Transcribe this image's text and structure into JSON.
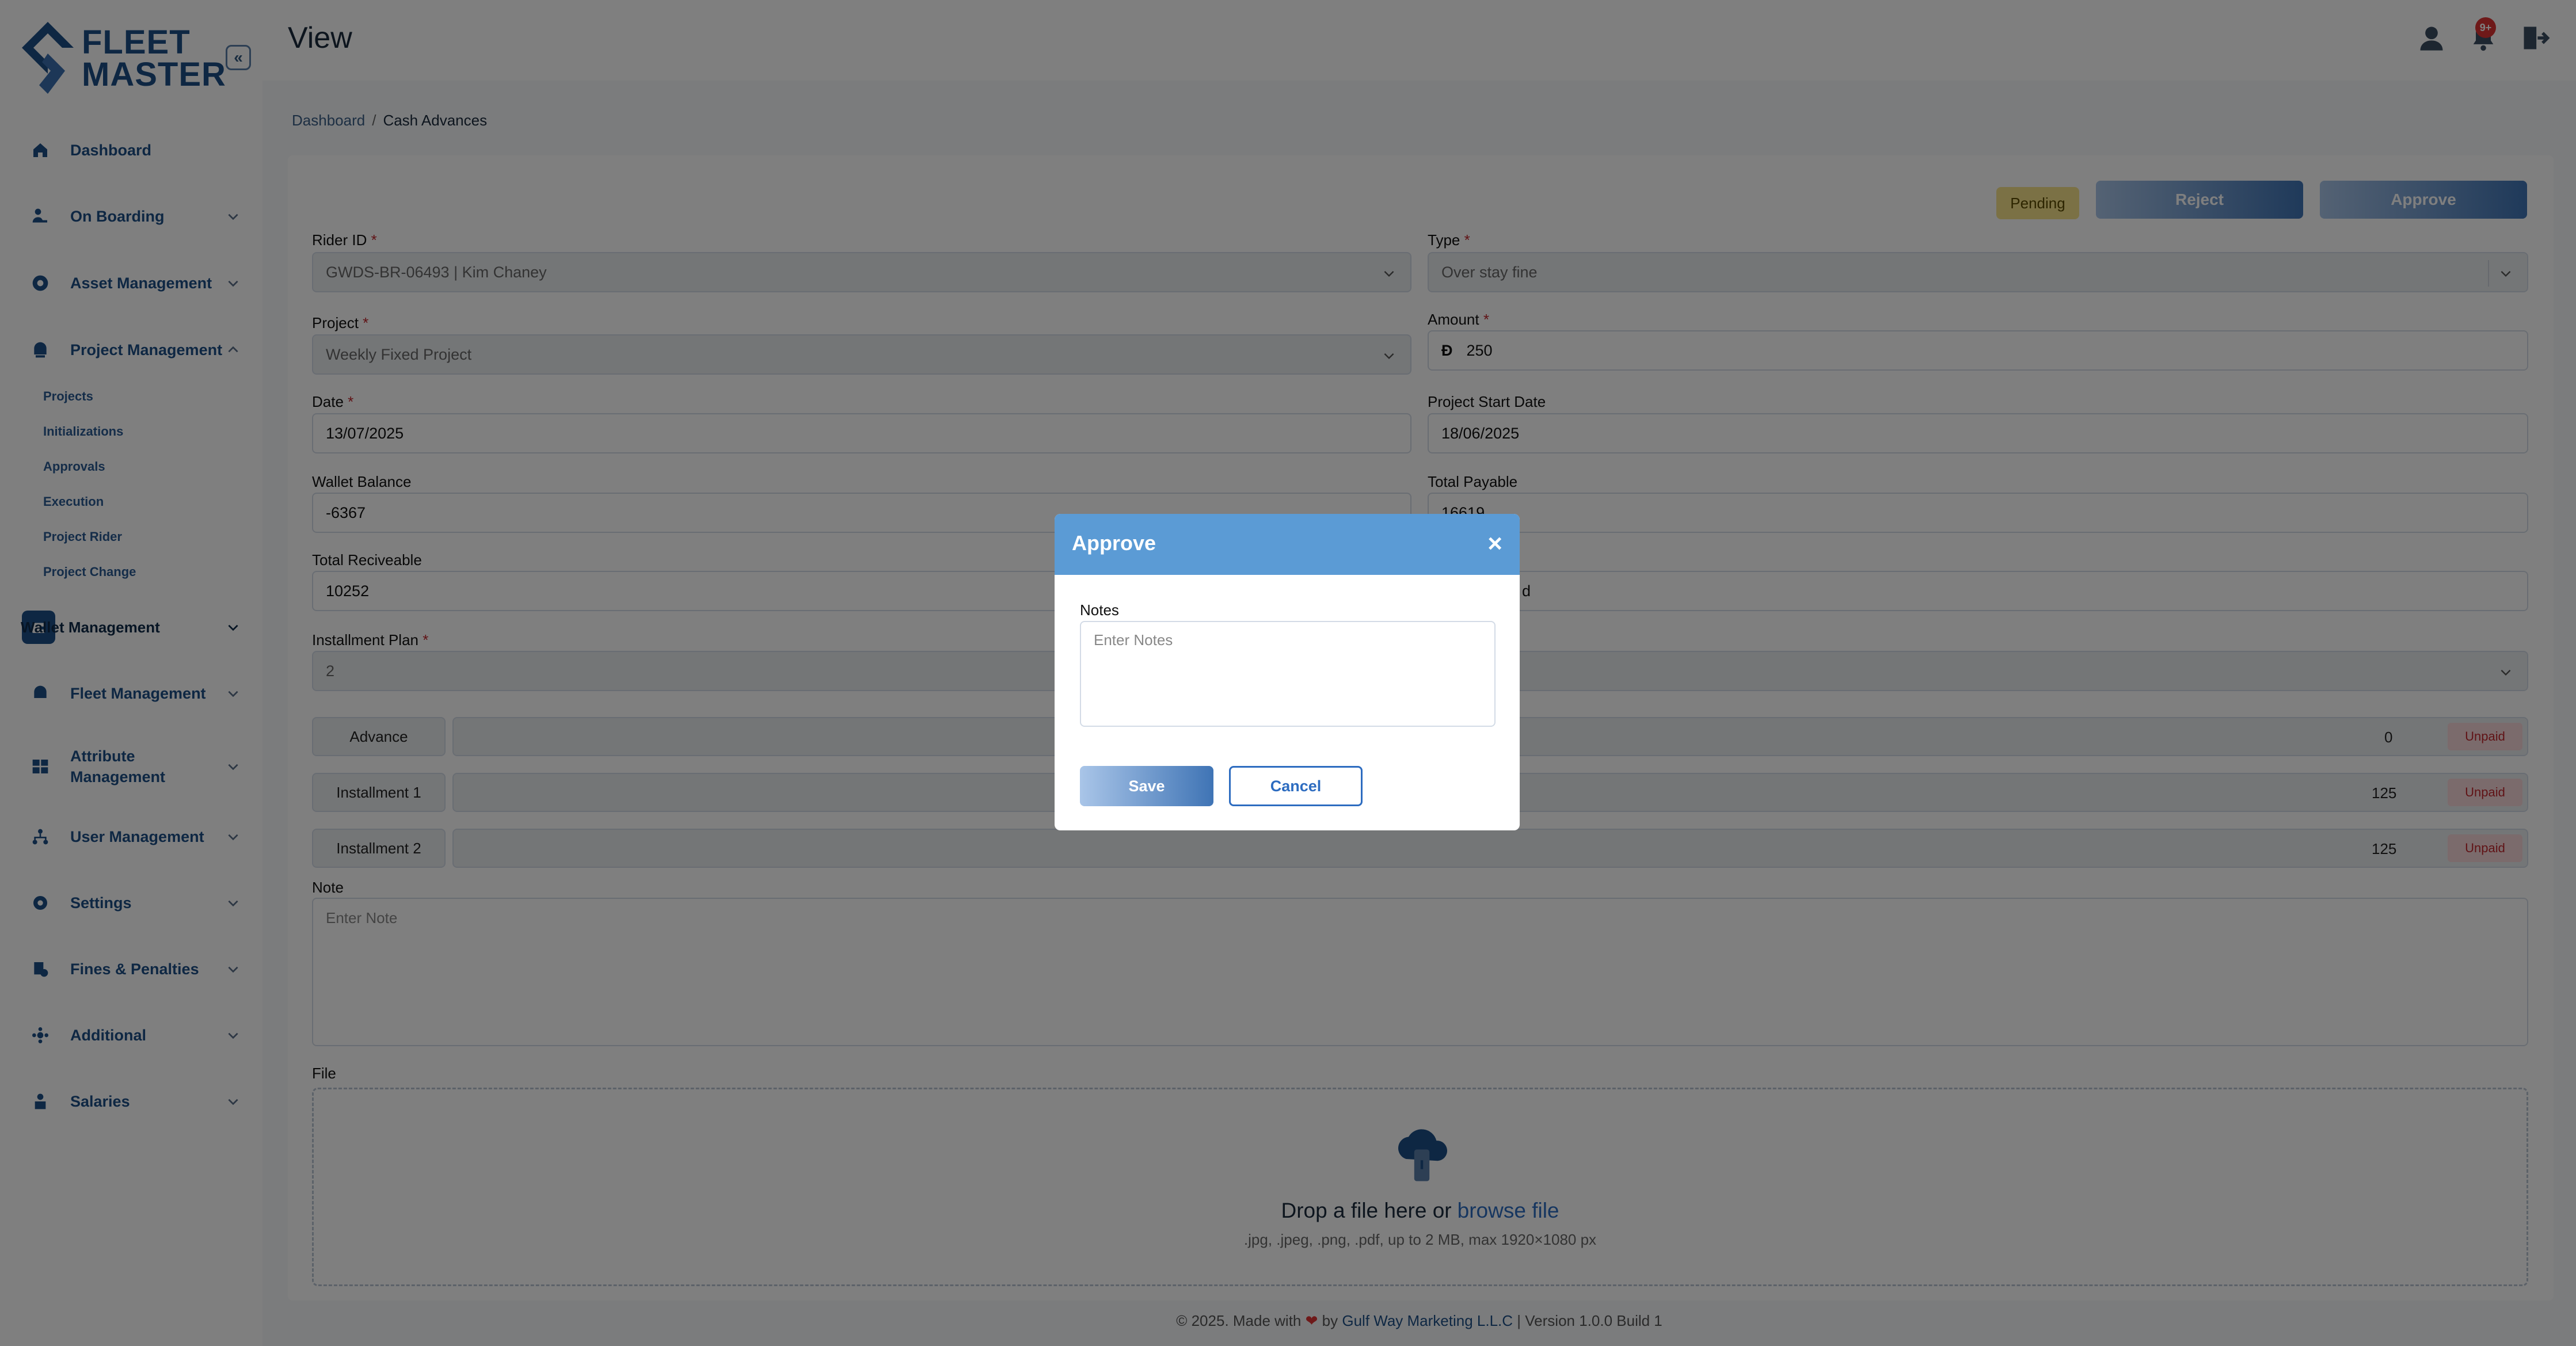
{
  "brand": {
    "line1": "FLEET",
    "line2": "MASTER"
  },
  "header": {
    "title": "View",
    "badge": "9+"
  },
  "sidebar": {
    "items": [
      {
        "label": "Dashboard"
      },
      {
        "label": "On Boarding"
      },
      {
        "label": "Asset Management"
      },
      {
        "label": "Project Management"
      },
      {
        "label": "Wallet Management"
      },
      {
        "label": "Fleet Management"
      },
      {
        "label": "Attribute Management"
      },
      {
        "label": "User Management"
      },
      {
        "label": "Settings"
      },
      {
        "label": "Fines & Penalties"
      },
      {
        "label": "Additional"
      },
      {
        "label": "Salaries"
      }
    ],
    "sub": [
      "Projects",
      "Initializations",
      "Approvals",
      "Execution",
      "Project Rider",
      "Project Change"
    ]
  },
  "breadcrumb": {
    "root": "Dashboard",
    "sep": "/",
    "current": "Cash Advances"
  },
  "status": {
    "pending": "Pending",
    "reject": "Reject",
    "approve": "Approve"
  },
  "form": {
    "rider_id": {
      "label": "Rider ID",
      "value": "GWDS-BR-06493 | Kim Chaney"
    },
    "type": {
      "label": "Type",
      "value": "Over stay fine"
    },
    "project": {
      "label": "Project",
      "value": "Weekly Fixed Project"
    },
    "amount": {
      "label": "Amount",
      "currency": "Ð",
      "value": "250"
    },
    "date": {
      "label": "Date",
      "value": "13/07/2025"
    },
    "project_start": {
      "label": "Project Start Date",
      "value": "18/06/2025"
    },
    "wallet_balance": {
      "label": "Wallet Balance",
      "value": "-6367"
    },
    "total_payable": {
      "label": "Total Payable",
      "value": "16619"
    },
    "total_receivable": {
      "label": "Total Reciveable",
      "value": "10252"
    },
    "hidden_right_value": "d",
    "installment_plan": {
      "label": "Installment Plan",
      "value": "2"
    },
    "required_mark": "*",
    "installments": [
      {
        "label": "Advance",
        "amount": "0",
        "status": "Unpaid"
      },
      {
        "label": "Installment 1",
        "amount": "125",
        "status": "Unpaid"
      },
      {
        "label": "Installment 2",
        "amount": "125",
        "status": "Unpaid"
      }
    ],
    "note": {
      "label": "Note",
      "placeholder": "Enter Note"
    },
    "file": {
      "label": "File",
      "drop_text": "Drop a file here or",
      "browse": "browse file",
      "hint": ".jpg, .jpeg, .png, .pdf, up to 2 MB, max 1920×1080 px"
    }
  },
  "footer": {
    "prefix": "© 2025. Made with",
    "by": "by",
    "company": "Gulf Way Marketing L.L.C",
    "suffix": "| Version 1.0.0 Build 1"
  },
  "modal": {
    "title": "Approve",
    "close": "×",
    "notes_label": "Notes",
    "notes_placeholder": "Enter Notes",
    "save": "Save",
    "cancel": "Cancel"
  },
  "colors": {
    "brand": "#1d4f86",
    "modal_header": "#5b9bd5",
    "danger": "#c0262d",
    "pending": "#f7e38a"
  }
}
